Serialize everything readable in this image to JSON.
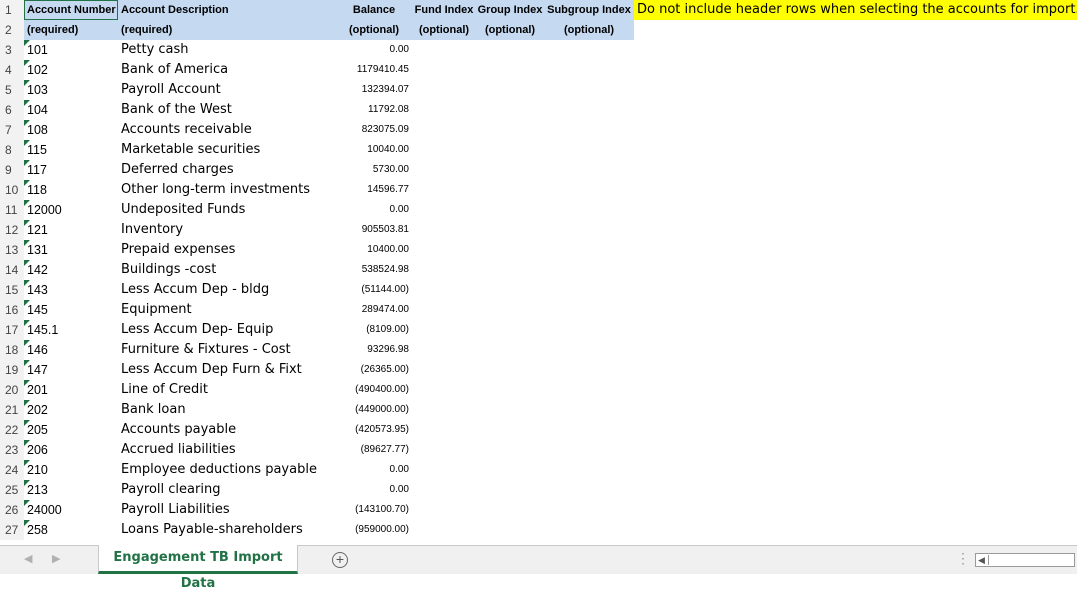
{
  "header": {
    "row1": {
      "num": "1",
      "account": "Account Number",
      "description": "Account Description",
      "balance": "Balance",
      "fund": "Fund Index",
      "group": "Group Index",
      "subgroup": "Subgroup Index",
      "note": "Do not include header rows when selecting the accounts for import."
    },
    "row2": {
      "num": "2",
      "account": "(required)",
      "description": "(required)",
      "balance": "(optional)",
      "fund": "(optional)",
      "group": "(optional)",
      "subgroup": "(optional)"
    }
  },
  "rows": [
    {
      "num": "3",
      "account": "101",
      "description": "Petty cash",
      "balance": "0.00"
    },
    {
      "num": "4",
      "account": "102",
      "description": "Bank of America",
      "balance": "1179410.45"
    },
    {
      "num": "5",
      "account": "103",
      "description": "Payroll Account",
      "balance": "132394.07"
    },
    {
      "num": "6",
      "account": "104",
      "description": "Bank of the West",
      "balance": "11792.08"
    },
    {
      "num": "7",
      "account": "108",
      "description": "Accounts receivable",
      "balance": "823075.09"
    },
    {
      "num": "8",
      "account": "115",
      "description": "Marketable securities",
      "balance": "10040.00"
    },
    {
      "num": "9",
      "account": "117",
      "description": "Deferred charges",
      "balance": "5730.00"
    },
    {
      "num": "10",
      "account": "118",
      "description": "Other long-term investments",
      "balance": "14596.77"
    },
    {
      "num": "11",
      "account": "12000",
      "description": "Undeposited Funds",
      "balance": "0.00"
    },
    {
      "num": "12",
      "account": "121",
      "description": "Inventory",
      "balance": "905503.81"
    },
    {
      "num": "13",
      "account": "131",
      "description": "Prepaid expenses",
      "balance": "10400.00"
    },
    {
      "num": "14",
      "account": "142",
      "description": "Buildings -cost",
      "balance": "538524.98"
    },
    {
      "num": "15",
      "account": "143",
      "description": "Less Accum Dep - bldg",
      "balance": "(51144.00)"
    },
    {
      "num": "16",
      "account": "145",
      "description": "Equipment",
      "balance": "289474.00"
    },
    {
      "num": "17",
      "account": "145.1",
      "description": "Less Accum Dep- Equip",
      "balance": "(8109.00)"
    },
    {
      "num": "18",
      "account": "146",
      "description": "Furniture & Fixtures - Cost",
      "balance": "93296.98"
    },
    {
      "num": "19",
      "account": "147",
      "description": "Less Accum Dep Furn & Fixt",
      "balance": "(26365.00)"
    },
    {
      "num": "20",
      "account": "201",
      "description": "Line of Credit",
      "balance": "(490400.00)"
    },
    {
      "num": "21",
      "account": "202",
      "description": "Bank loan",
      "balance": "(449000.00)"
    },
    {
      "num": "22",
      "account": "205",
      "description": "Accounts payable",
      "balance": "(420573.95)"
    },
    {
      "num": "23",
      "account": "206",
      "description": "Accrued liabilities",
      "balance": "(89627.77)"
    },
    {
      "num": "24",
      "account": "210",
      "description": "Employee deductions payable",
      "balance": "0.00"
    },
    {
      "num": "25",
      "account": "213",
      "description": "Payroll clearing",
      "balance": "0.00"
    },
    {
      "num": "26",
      "account": "24000",
      "description": "Payroll Liabilities",
      "balance": "(143100.70)"
    },
    {
      "num": "27",
      "account": "258",
      "description": "Loans Payable-shareholders",
      "balance": "(959000.00)"
    }
  ],
  "tabs": {
    "active_label": "Engagement TB Import Data",
    "add_icon": "plus-circle-icon",
    "prev_icon": "chevron-left-icon",
    "next_icon": "chevron-right-icon",
    "more_icon": "ellipsis-vertical-icon"
  },
  "colors": {
    "header_fill": "#c5d9f1",
    "note_fill": "#ffff00",
    "accent": "#217346"
  }
}
